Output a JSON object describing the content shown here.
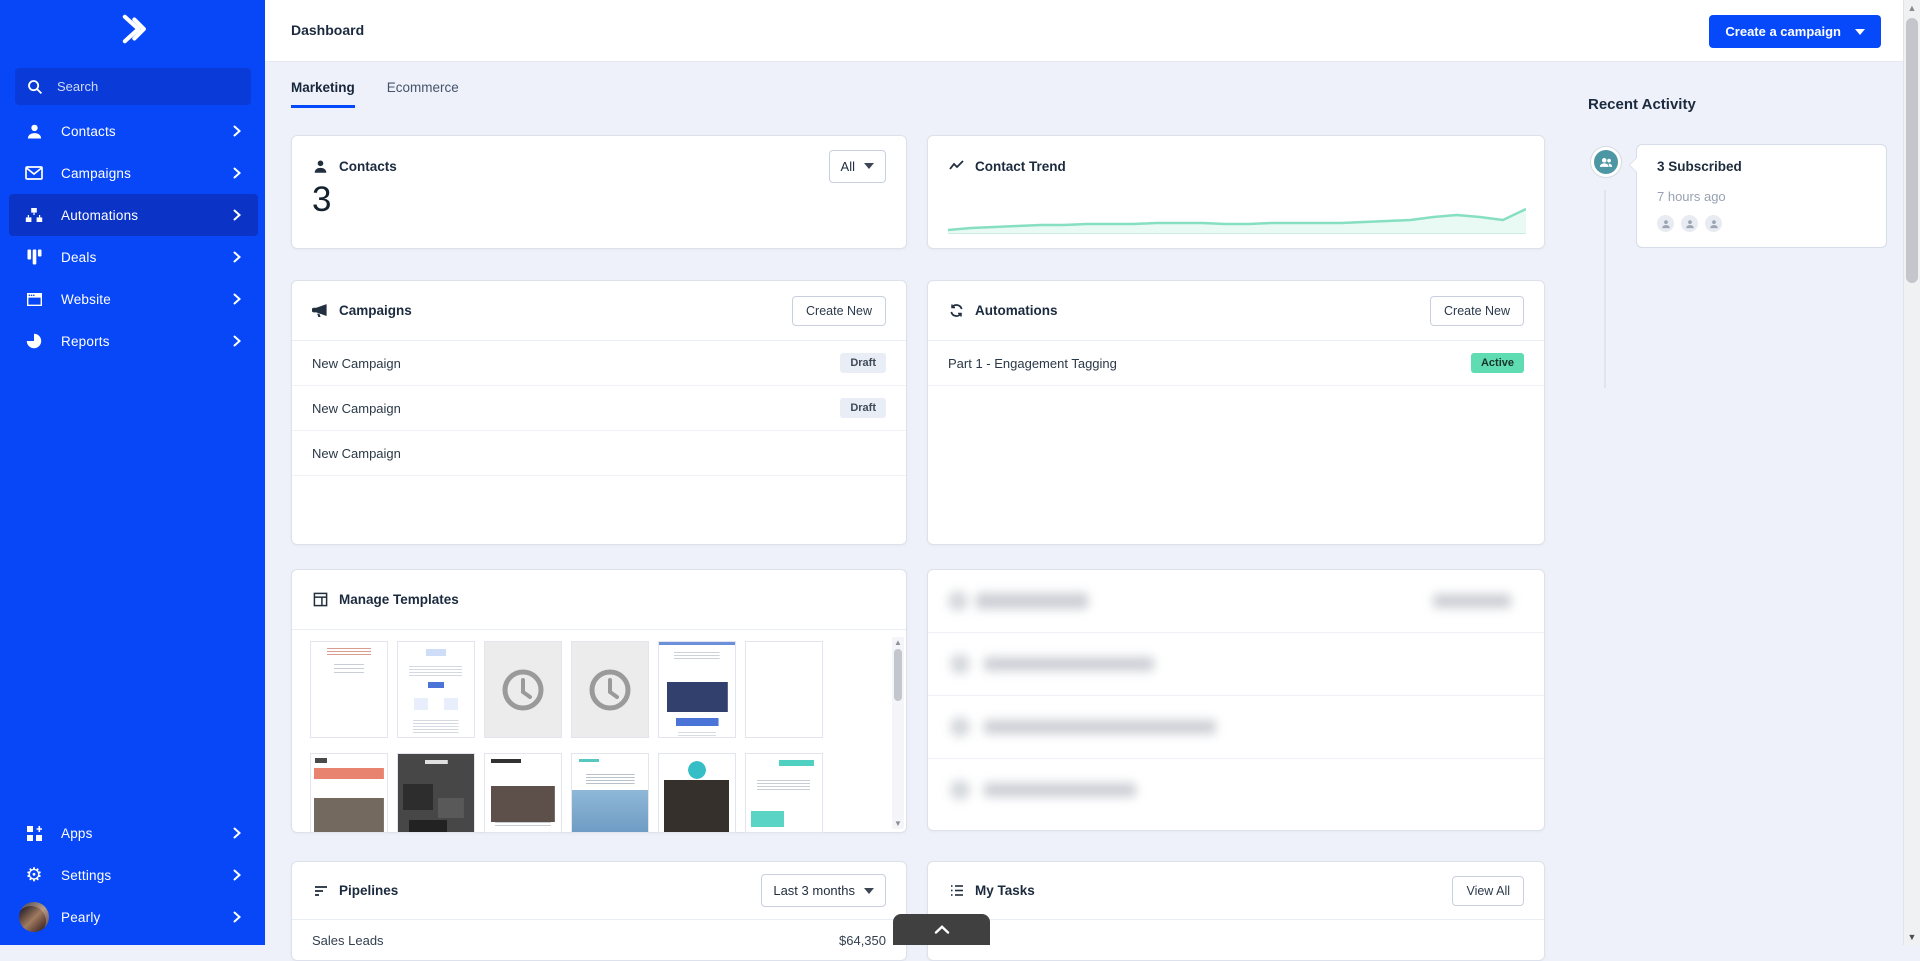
{
  "sidebar": {
    "search": {
      "placeholder": "Search"
    },
    "items": [
      {
        "label": "Contacts",
        "icon": "person",
        "active": false
      },
      {
        "label": "Campaigns",
        "icon": "envelope",
        "active": false
      },
      {
        "label": "Automations",
        "icon": "automation",
        "active": true
      },
      {
        "label": "Deals",
        "icon": "deals",
        "active": false
      },
      {
        "label": "Website",
        "icon": "website",
        "active": false
      },
      {
        "label": "Reports",
        "icon": "reports",
        "active": false
      }
    ],
    "bottom_items": [
      {
        "label": "Apps",
        "icon": "apps",
        "active": false
      },
      {
        "label": "Settings",
        "icon": "gear",
        "active": false
      },
      {
        "label": "Pearly",
        "icon": "avatar",
        "active": false
      }
    ]
  },
  "header": {
    "title": "Dashboard",
    "create_campaign_label": "Create a campaign"
  },
  "tabs": [
    {
      "label": "Marketing",
      "active": true
    },
    {
      "label": "Ecommerce",
      "active": false
    }
  ],
  "cards": {
    "contacts": {
      "title": "Contacts",
      "count": "3",
      "filter_value": "All"
    },
    "contact_trend": {
      "title": "Contact Trend",
      "chart_data": {
        "type": "area",
        "series_name": "Contacts",
        "color": "#86dfc0",
        "points": [
          3,
          5,
          6,
          7,
          8,
          8,
          9,
          9,
          9,
          10,
          10,
          10,
          9,
          9,
          10,
          10,
          10,
          10,
          11,
          12,
          13,
          16,
          18,
          16,
          13,
          24
        ]
      }
    },
    "campaigns": {
      "title": "Campaigns",
      "action_label": "Create New",
      "rows": [
        {
          "name": "New Campaign",
          "status": "Draft"
        },
        {
          "name": "New Campaign",
          "status": "Draft"
        },
        {
          "name": "New Campaign",
          "status": ""
        }
      ]
    },
    "automations": {
      "title": "Automations",
      "action_label": "Create New",
      "rows": [
        {
          "name": "Part 1 - Engagement Tagging",
          "status": "Active"
        }
      ]
    },
    "templates": {
      "title": "Manage Templates",
      "thumbnails_row1": [
        "letter",
        "newsletter",
        "clock",
        "clock",
        "promo",
        "blank"
      ],
      "thumbnails_row2": [
        "modernist",
        "dark-collage",
        "portfolio",
        "sky",
        "profile",
        "teal"
      ]
    },
    "pipelines": {
      "title": "Pipelines",
      "filter_value": "Last 3 months",
      "rows": [
        {
          "name": "Sales Leads",
          "value": "$64,350"
        }
      ]
    },
    "tasks": {
      "title": "My Tasks",
      "action_label": "View All"
    }
  },
  "activity": {
    "title": "Recent Activity",
    "items": [
      {
        "title": "3 Subscribed",
        "time": "7 hours ago",
        "avatar_count": 3
      }
    ]
  },
  "colors": {
    "brand_blue": "#0549fb",
    "mint_badge": "#5fdcb2",
    "trend_line": "#86dfc0"
  }
}
